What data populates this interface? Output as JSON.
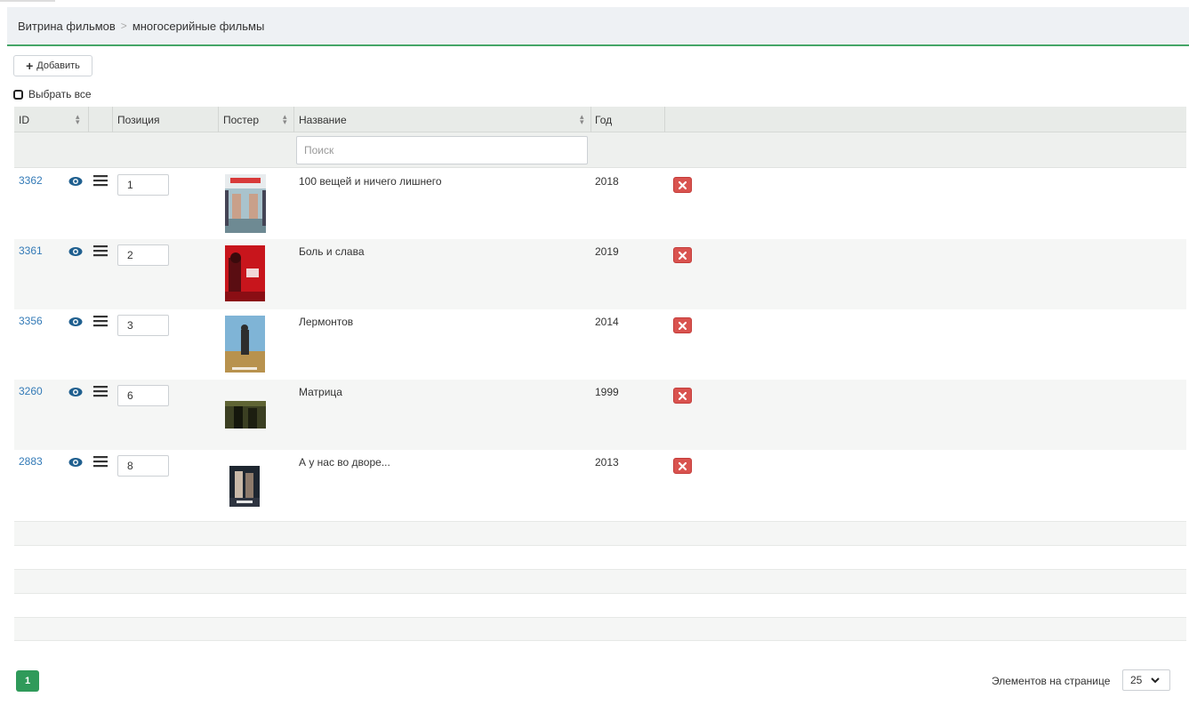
{
  "breadcrumb": {
    "root": "Витрина фильмов",
    "separator": ">",
    "current": "многосерийные фильмы"
  },
  "toolbar": {
    "add_label": "Добавить",
    "select_all_label": "Выбрать все"
  },
  "table": {
    "columns": {
      "id": "ID",
      "position": "Позиция",
      "poster": "Постер",
      "title": "Название",
      "year": "Год"
    },
    "search_placeholder": "Поиск",
    "rows": [
      {
        "id": "3362",
        "position": "1",
        "title": "100 вещей и ничего лишнего",
        "year": "2018"
      },
      {
        "id": "3361",
        "position": "2",
        "title": "Боль и слава",
        "year": "2019"
      },
      {
        "id": "3356",
        "position": "3",
        "title": "Лермонтов",
        "year": "2014"
      },
      {
        "id": "3260",
        "position": "6",
        "title": "Матрица",
        "year": "1999"
      },
      {
        "id": "2883",
        "position": "8",
        "title": "А у нас во дворе...",
        "year": "2013"
      }
    ]
  },
  "pagination": {
    "current_page": "1",
    "per_page_label": "Элементов на странице",
    "per_page_value": "25"
  },
  "colors": {
    "accent": "#45a667",
    "link": "#337ab7",
    "danger": "#d9534f"
  }
}
